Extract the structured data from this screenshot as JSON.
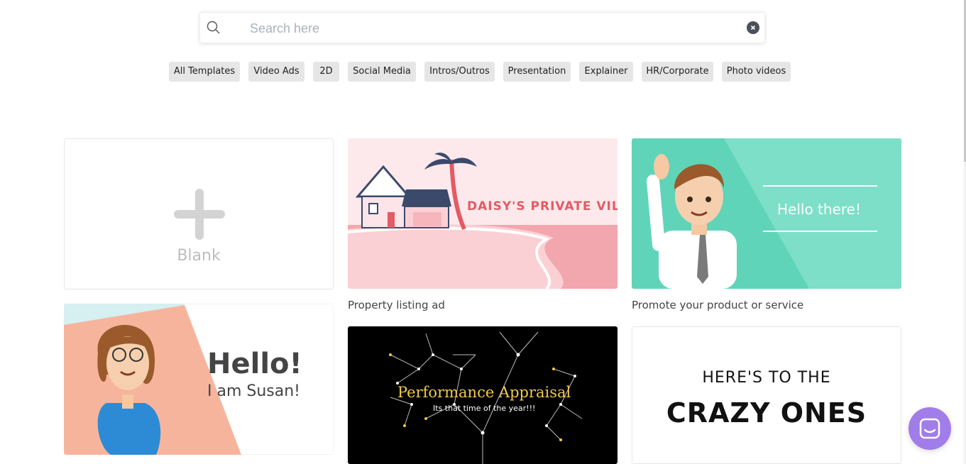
{
  "search": {
    "placeholder": "Search here",
    "value": ""
  },
  "filters": [
    "All Templates",
    "Video Ads",
    "2D",
    "Social Media",
    "Intros/Outros",
    "Presentation",
    "Explainer",
    "HR/Corporate",
    "Photo videos"
  ],
  "blank": {
    "label": "Blank"
  },
  "templates": {
    "property": {
      "caption": "Property listing ad",
      "title": "DAISY'S PRIVATE VILLA"
    },
    "promote": {
      "caption": "Promote your product or service",
      "title": "Hello there!"
    },
    "susan": {
      "title": "Hello!",
      "subtitle": "I am Susan!"
    },
    "appraisal": {
      "title": "Performance Appraisal",
      "subtitle": "Its that time of the year!!!"
    },
    "crazy": {
      "line1": "HERE'S TO THE",
      "line2": "CRAZY ONES"
    }
  },
  "colors": {
    "accent_chat": "#a07de8",
    "chip_bg": "#e6e6e6",
    "teal": "#5fd4b8",
    "pink": "#f4a3a8",
    "salmon": "#f7b49c"
  },
  "icons": {
    "search": "search-icon",
    "clear": "clear-icon",
    "plus": "plus-icon",
    "chat": "chat-icon"
  }
}
